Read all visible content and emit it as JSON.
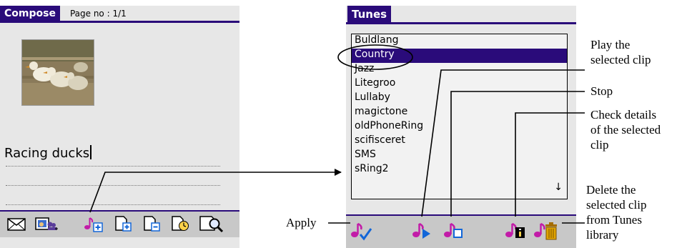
{
  "compose": {
    "tab_label": "Compose",
    "page_info": "Page no : 1/1",
    "caption": "Racing ducks",
    "toolbar_icons": [
      "envelope-icon",
      "photo-contacts-icon",
      "add-music-icon",
      "add-page-icon",
      "remove-page-icon",
      "page-timer-icon",
      "preview-icon"
    ]
  },
  "tunes": {
    "tab_label": "Tunes",
    "items": [
      "Buldlang",
      "Country",
      "Jazz",
      "Litegroo",
      "Lullaby",
      "magictone",
      "oldPhoneRing",
      "scifisceret",
      "SMS",
      "sRing2"
    ],
    "selected_index": 1,
    "scroll_glyph": "↓",
    "toolbar_icons": [
      "apply-icon",
      "play-icon",
      "stop-icon",
      "details-icon",
      "delete-icon"
    ]
  },
  "annotations": {
    "play": [
      "Play the",
      "selected clip"
    ],
    "stop": [
      "Stop"
    ],
    "details": [
      "Check details",
      "of the selected",
      "clip"
    ],
    "delete": [
      "Delete the",
      "selected clip",
      "from Tunes",
      "library"
    ],
    "apply": [
      "Apply"
    ]
  },
  "colors": {
    "accent": "#2a0b7a",
    "screen_bg": "#e7e7e7",
    "toolbar_bg": "#c8c8c8",
    "note_icon": "#c21ca8",
    "stop_blue": "#1266d8",
    "trash": "#e0a400"
  }
}
